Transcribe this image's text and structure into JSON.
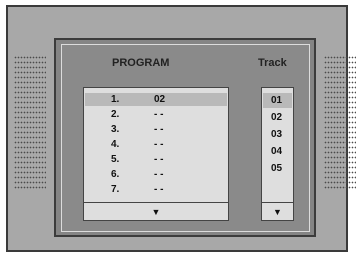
{
  "program": {
    "title": "PROGRAM",
    "rows": [
      {
        "num": "1.",
        "value": "02"
      },
      {
        "num": "2.",
        "value": "- -"
      },
      {
        "num": "3.",
        "value": "- -"
      },
      {
        "num": "4.",
        "value": "- -"
      },
      {
        "num": "5.",
        "value": "- -"
      },
      {
        "num": "6.",
        "value": "- -"
      },
      {
        "num": "7.",
        "value": "- -"
      }
    ],
    "scroll_icon": "triangle-down-icon",
    "scroll_glyph": "▼"
  },
  "track": {
    "title": "Track",
    "items": [
      "01",
      "02",
      "03",
      "04",
      "05"
    ],
    "scroll_icon": "triangle-down-icon",
    "scroll_glyph": "▼"
  },
  "colors": {
    "frame": "#a8a8a8",
    "screen": "#858585",
    "panel": "#dedede",
    "selection": "#b9b9b9"
  }
}
